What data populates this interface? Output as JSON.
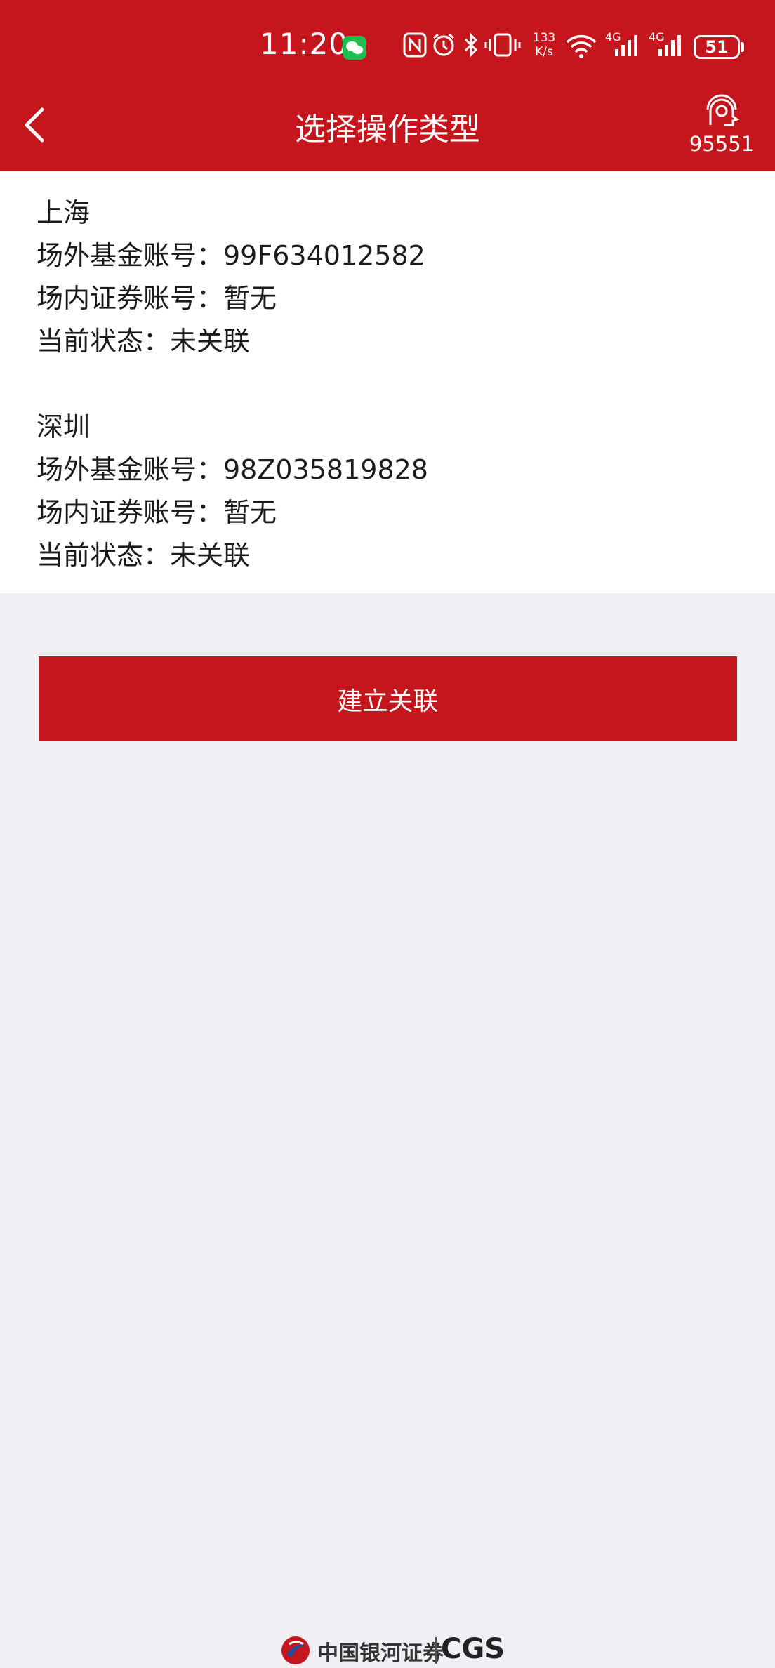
{
  "status_bar": {
    "time": "11:20",
    "net_speed_value": "133",
    "net_speed_unit": "K/s",
    "signal_1": "4G",
    "signal_2": "4G",
    "battery": "51"
  },
  "header": {
    "title": "选择操作类型",
    "hotline": "95551"
  },
  "accounts": [
    {
      "region": "上海",
      "fund_account": "场外基金账号：99F634012582",
      "securities_account": "场内证券账号：暂无",
      "status": "当前状态：未关联"
    },
    {
      "region": "深圳",
      "fund_account": "场外基金账号：98Z035819828",
      "securities_account": "场内证券账号：暂无",
      "status": "当前状态：未关联"
    }
  ],
  "action_button": "建立关联",
  "footer": {
    "brand_cn": "中国银河证券",
    "brand_en": "CGS"
  },
  "colors": {
    "brand_red": "#c5161d",
    "page_bg": "#efeff4"
  }
}
